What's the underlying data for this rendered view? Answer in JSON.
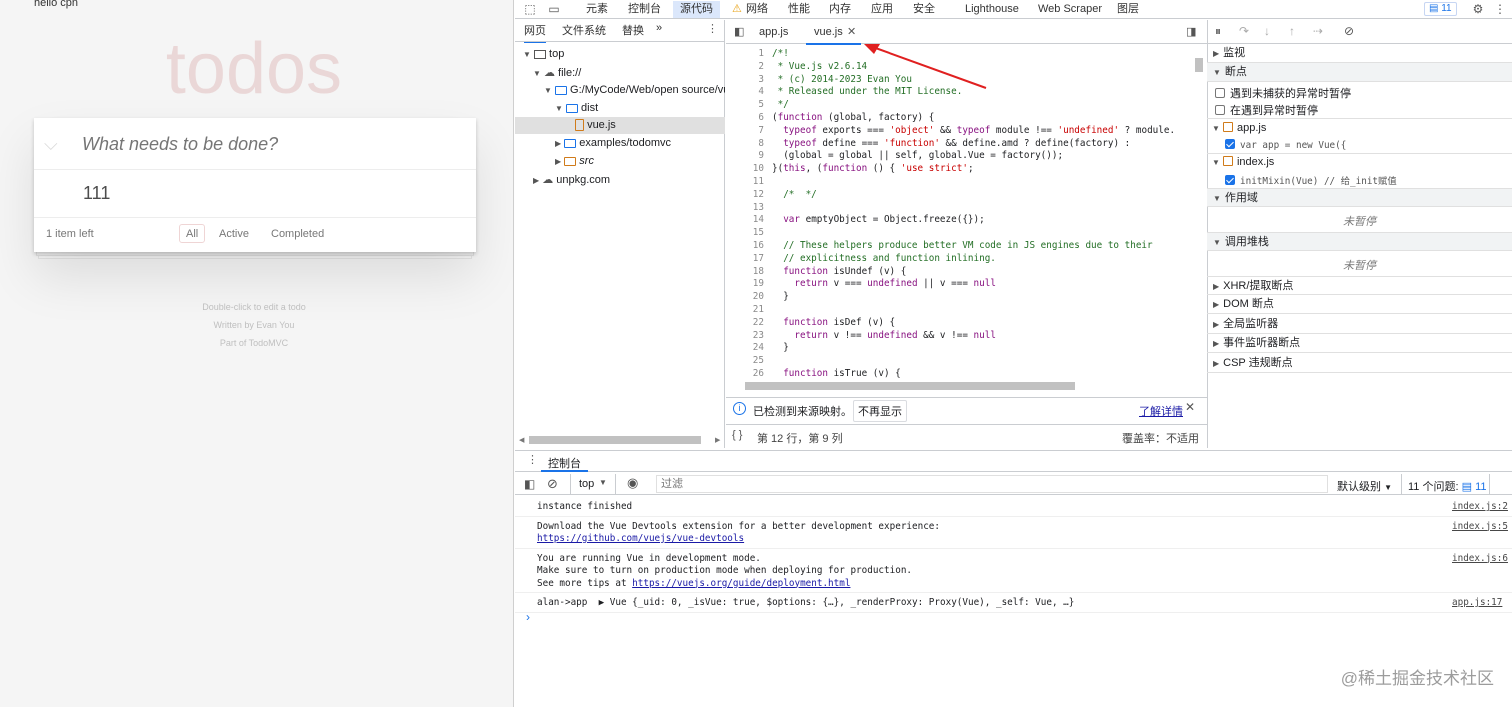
{
  "app": {
    "hello_text": "hello cpn",
    "title": "todos",
    "new_todo_placeholder": "What needs to be done?",
    "toggle_icon": "chevron-down-icon",
    "todo_items": [
      "111"
    ],
    "count_text": "1 item left",
    "filters": [
      "All",
      "Active",
      "Completed"
    ],
    "selected_filter": "All",
    "info": [
      "Double-click to edit a todo",
      "Written by Evan You",
      "Part of TodoMVC"
    ],
    "title_color": "#efd9d9"
  },
  "devtools": {
    "top_tabs": [
      "元素",
      "控制台",
      "源代码",
      "网络",
      "性能",
      "内存",
      "应用",
      "安全",
      "Lighthouse",
      "Web Scraper",
      "图层"
    ],
    "active_top_tab": "源代码",
    "network_warning_icon": "warning-icon",
    "issues_badge": "11",
    "nav_tabs": [
      "网页",
      "文件系统",
      "替换"
    ],
    "nav_more": "»",
    "tree": [
      {
        "label": "top",
        "icon": "frame-icon"
      },
      {
        "label": "file://",
        "icon": "cloud-icon"
      },
      {
        "label": "G:/MyCode/Web/open source/vu",
        "icon": "folder-icon"
      },
      {
        "label": "dist",
        "icon": "folder-icon"
      },
      {
        "label": "vue.js",
        "icon": "file-icon"
      },
      {
        "label": "examples/todomvc",
        "icon": "folder-icon"
      },
      {
        "label": "src",
        "icon": "folder-icon"
      },
      {
        "label": "unpkg.com",
        "icon": "cloud-icon"
      }
    ],
    "editor_tabs": [
      {
        "label": "app.js"
      },
      {
        "label": "vue.js",
        "active": true
      }
    ],
    "code_lines": [
      "/*!",
      " * Vue.js v2.6.14",
      " * (c) 2014-2023 Evan You",
      " * Released under the MIT License.",
      " */",
      "(function (global, factory) {",
      "  typeof exports === 'object' && typeof module !== 'undefined' ? module.",
      "  typeof define === 'function' && define.amd ? define(factory) :",
      "  (global = global || self, global.Vue = factory());",
      "}(this, (function () { 'use strict';",
      "",
      "  /*  */",
      "",
      "  var emptyObject = Object.freeze({});",
      "",
      "  // These helpers produce better VM code in JS engines due to their",
      "  // explicitness and function inlining.",
      "  function isUndef (v) {",
      "    return v === undefined || v === null",
      "  }",
      "",
      "  function isDef (v) {",
      "    return v !== undefined && v !== null",
      "  }",
      "",
      "  function isTrue (v) {"
    ],
    "sourcemap_msg": "已检测到来源映射。",
    "sourcemap_dismiss": "不再显示",
    "sourcemap_link": "了解详情",
    "status_position": "第 12 行，第 9 列",
    "status_coverage": "覆盖率：不适用",
    "right_sections": {
      "watch": "监视",
      "breakpoints": "断点",
      "pause_uncaught": "遇到未捕获的异常时暂停",
      "pause_caught": "在遇到异常时暂停",
      "bp_files": [
        {
          "file": "app.js",
          "code": "var app = new Vue({"
        },
        {
          "file": "index.js",
          "code": "initMixin(Vue) // 给_init赋值"
        }
      ],
      "scope": "作用域",
      "not_paused": "未暂停",
      "call_stack": "调用堆栈",
      "others": [
        "XHR/提取断点",
        "DOM 断点",
        "全局监听器",
        "事件监听器断点",
        "CSP 违规断点"
      ]
    },
    "console": {
      "tab_label": "控制台",
      "context": "top",
      "filter_placeholder": "过滤",
      "level": "默认级别",
      "issues": "11 个问题:",
      "issues_badge": "11",
      "messages": [
        {
          "lines": [
            "instance finished"
          ],
          "source": "index.js:2"
        },
        {
          "lines": [
            "Download the Vue Devtools extension for a better development experience:",
            "https://github.com/vuejs/vue-devtools"
          ],
          "source": "index.js:5"
        },
        {
          "lines": [
            "You are running Vue in development mode.",
            "Make sure to turn on production mode when deploying for production.",
            "See more tips at https://vuejs.org/guide/deployment.html"
          ],
          "source": "index.js:6"
        },
        {
          "lines": [
            "alan->app  ▶ Vue {_uid: 0, _isVue: true, $options: {…}, _renderProxy: Proxy(Vue), _self: Vue, …}"
          ],
          "source": "app.js:17"
        }
      ],
      "prompt": "›"
    }
  },
  "watermark": "@稀土掘金技术社区"
}
